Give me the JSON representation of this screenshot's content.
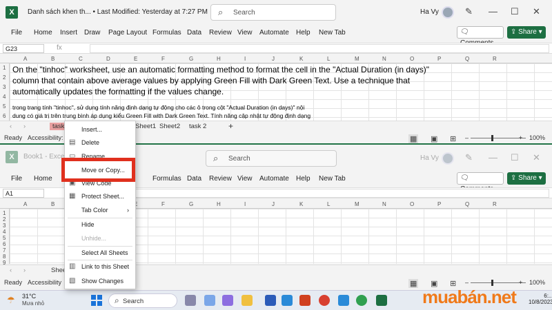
{
  "window1": {
    "title": "Danh sách khen th...",
    "modified": "• Last Modified: Yesterday at 7:27 PM",
    "search_label": "Search",
    "user": "Ha Vy",
    "menu": [
      "File",
      "Home",
      "Insert",
      "Draw",
      "Page Layout",
      "Formulas",
      "Data",
      "Review",
      "View",
      "Automate",
      "Help",
      "New Tab"
    ],
    "comments_label": "Comments",
    "share_label": "Share",
    "namebox": "G23",
    "fx": "fx",
    "columns": [
      "A",
      "B",
      "C",
      "D",
      "E",
      "F",
      "G",
      "H",
      "I",
      "J",
      "K",
      "L",
      "M",
      "N",
      "O",
      "P",
      "Q",
      "R"
    ],
    "rows": [
      "1",
      "2",
      "3",
      "4",
      "5",
      "6"
    ],
    "cell_text_lines": [
      "On the \"tinhoc\" worksheet, use an automatic formatting method to format the cell in the \"Actual Duration (in days)\"",
      "column that contain above average  values by applying Green Fill with Dark Green Text. Use a technique that",
      "automatically updates the formatting if the values change."
    ],
    "cell_vn_lines": [
      "trong trang tính \"tinhoc\", sử dụng tính năng định dạng tự động cho các ô trong cột \"Actual Duration (in days)\" nội",
      "dung có giá trị trên trung bình áp dụng kiểu Green Fill with Dark Green Text. Tính năng cập nhật tự động định dạng"
    ],
    "sheet_tabs": [
      "task",
      "Sheet1",
      "Sheet2",
      "task 2",
      "+"
    ],
    "status": [
      "Ready",
      "Accessibility: ..."
    ],
    "zoom": "100%"
  },
  "window2": {
    "title": "Book1 - Exce",
    "search_label": "Search",
    "user": "Ha Vy",
    "menu": [
      "File",
      "Home",
      "Insert",
      "Draw",
      "Page Layout",
      "Formulas",
      "Data",
      "Review",
      "View",
      "Automate",
      "Help",
      "New Tab"
    ],
    "comments_label": "Comments",
    "share_label": "Share",
    "namebox": "A1",
    "columns": [
      "A",
      "B",
      "C",
      "D",
      "E",
      "F",
      "G",
      "H",
      "I",
      "J",
      "K",
      "L",
      "M",
      "N",
      "O",
      "P",
      "Q",
      "R"
    ],
    "rows": [
      "1",
      "2",
      "3",
      "4",
      "5",
      "6",
      "7",
      "8",
      "9"
    ],
    "sheet_tab": "Shee",
    "status": [
      "Ready",
      "Accessibility"
    ],
    "zoom": "100%"
  },
  "context_menu": {
    "items": [
      {
        "label": "Insert...",
        "icon": "insert-icon",
        "enabled": true
      },
      {
        "label": "Delete",
        "icon": "delete-icon",
        "enabled": true
      },
      {
        "label": "Rename",
        "icon": "rename-icon",
        "enabled": true
      },
      {
        "label": "Move or Copy...",
        "icon": "",
        "enabled": true
      },
      {
        "label": "View Code",
        "icon": "view-code-icon",
        "enabled": true
      },
      {
        "label": "Protect Sheet...",
        "icon": "protect-sheet-icon",
        "enabled": true
      },
      {
        "label": "Tab Color",
        "icon": "",
        "enabled": true,
        "submenu": true
      },
      {
        "label": "Hide",
        "icon": "",
        "enabled": true
      },
      {
        "label": "Unhide...",
        "icon": "",
        "enabled": false
      },
      {
        "label": "Select All Sheets",
        "icon": "",
        "enabled": true
      },
      {
        "label": "Link to this Sheet",
        "icon": "link-icon",
        "enabled": true
      },
      {
        "label": "Show Changes",
        "icon": "show-changes-icon",
        "enabled": true
      }
    ],
    "submenu_arrow": "›"
  },
  "taskbar": {
    "temperature": "31°C",
    "weather": "Mưa nhỏ",
    "search_label": "Search",
    "clock_time": "6:...",
    "clock_date": "10/8/2023"
  },
  "watermark": "muabán.net",
  "colors": {
    "excel_green": "#1d6f42",
    "highlight_red": "#e0301e",
    "watermark_orange": "#f07a1a"
  }
}
